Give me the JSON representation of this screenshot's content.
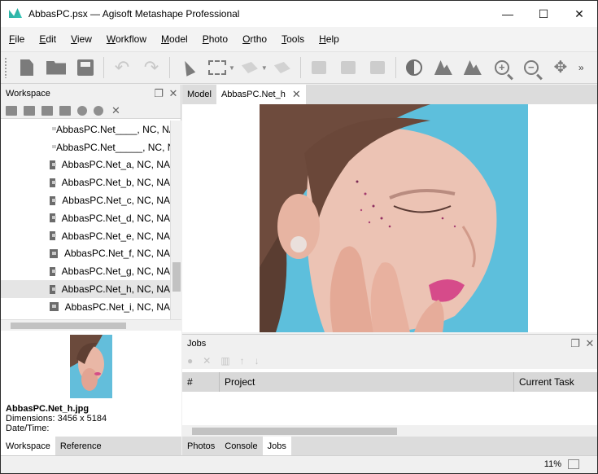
{
  "window": {
    "title": "AbbasPC.psx — Agisoft Metashape Professional",
    "minimize": "—",
    "maximize": "☐",
    "close": "✕"
  },
  "menu": [
    {
      "accel": "F",
      "rest": "ile"
    },
    {
      "accel": "E",
      "rest": "dit"
    },
    {
      "accel": "V",
      "rest": "iew"
    },
    {
      "accel": "W",
      "rest": "orkflow"
    },
    {
      "accel": "M",
      "rest": "odel"
    },
    {
      "accel": "P",
      "rest": "hoto"
    },
    {
      "accel": "O",
      "rest": "rtho"
    },
    {
      "accel": "T",
      "rest": "ools"
    },
    {
      "accel": "H",
      "rest": "elp"
    }
  ],
  "toolbar": {
    "more": "»"
  },
  "workspace": {
    "title": "Workspace",
    "items": [
      "AbbasPC.Net____, NC, NA",
      "AbbasPC.Net_____, NC, NA",
      "AbbasPC.Net_a, NC, NA",
      "AbbasPC.Net_b, NC, NA",
      "AbbasPC.Net_c, NC, NA",
      "AbbasPC.Net_d, NC, NA",
      "AbbasPC.Net_e, NC, NA",
      "AbbasPC.Net_f, NC, NA",
      "AbbasPC.Net_g, NC, NA",
      "AbbasPC.Net_h, NC, NA",
      "AbbasPC.Net_i, NC, NA"
    ],
    "selected_index": 9
  },
  "preview": {
    "filename": "AbbasPC.Net_h.jpg",
    "dimensions": "Dimensions: 3456 x 5184",
    "datetime": "Date/Time:"
  },
  "left_tabs": [
    "Workspace",
    "Reference"
  ],
  "view_tabs": {
    "model": "Model",
    "photo": "AbbasPC.Net_h"
  },
  "jobs": {
    "title": "Jobs",
    "columns": [
      "#",
      "Project",
      "Current Task"
    ]
  },
  "bottom_tabs": [
    "Photos",
    "Console",
    "Jobs"
  ],
  "status": {
    "zoom": "11%"
  }
}
